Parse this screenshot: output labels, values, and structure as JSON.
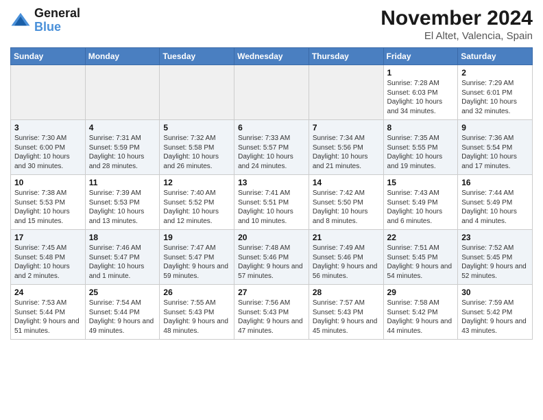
{
  "header": {
    "logo_line1": "General",
    "logo_line2": "Blue",
    "month_title": "November 2024",
    "location": "El Altet, Valencia, Spain"
  },
  "weekdays": [
    "Sunday",
    "Monday",
    "Tuesday",
    "Wednesday",
    "Thursday",
    "Friday",
    "Saturday"
  ],
  "weeks": [
    [
      {
        "day": "",
        "info": ""
      },
      {
        "day": "",
        "info": ""
      },
      {
        "day": "",
        "info": ""
      },
      {
        "day": "",
        "info": ""
      },
      {
        "day": "",
        "info": ""
      },
      {
        "day": "1",
        "info": "Sunrise: 7:28 AM\nSunset: 6:03 PM\nDaylight: 10 hours and 34 minutes."
      },
      {
        "day": "2",
        "info": "Sunrise: 7:29 AM\nSunset: 6:01 PM\nDaylight: 10 hours and 32 minutes."
      }
    ],
    [
      {
        "day": "3",
        "info": "Sunrise: 7:30 AM\nSunset: 6:00 PM\nDaylight: 10 hours and 30 minutes."
      },
      {
        "day": "4",
        "info": "Sunrise: 7:31 AM\nSunset: 5:59 PM\nDaylight: 10 hours and 28 minutes."
      },
      {
        "day": "5",
        "info": "Sunrise: 7:32 AM\nSunset: 5:58 PM\nDaylight: 10 hours and 26 minutes."
      },
      {
        "day": "6",
        "info": "Sunrise: 7:33 AM\nSunset: 5:57 PM\nDaylight: 10 hours and 24 minutes."
      },
      {
        "day": "7",
        "info": "Sunrise: 7:34 AM\nSunset: 5:56 PM\nDaylight: 10 hours and 21 minutes."
      },
      {
        "day": "8",
        "info": "Sunrise: 7:35 AM\nSunset: 5:55 PM\nDaylight: 10 hours and 19 minutes."
      },
      {
        "day": "9",
        "info": "Sunrise: 7:36 AM\nSunset: 5:54 PM\nDaylight: 10 hours and 17 minutes."
      }
    ],
    [
      {
        "day": "10",
        "info": "Sunrise: 7:38 AM\nSunset: 5:53 PM\nDaylight: 10 hours and 15 minutes."
      },
      {
        "day": "11",
        "info": "Sunrise: 7:39 AM\nSunset: 5:53 PM\nDaylight: 10 hours and 13 minutes."
      },
      {
        "day": "12",
        "info": "Sunrise: 7:40 AM\nSunset: 5:52 PM\nDaylight: 10 hours and 12 minutes."
      },
      {
        "day": "13",
        "info": "Sunrise: 7:41 AM\nSunset: 5:51 PM\nDaylight: 10 hours and 10 minutes."
      },
      {
        "day": "14",
        "info": "Sunrise: 7:42 AM\nSunset: 5:50 PM\nDaylight: 10 hours and 8 minutes."
      },
      {
        "day": "15",
        "info": "Sunrise: 7:43 AM\nSunset: 5:49 PM\nDaylight: 10 hours and 6 minutes."
      },
      {
        "day": "16",
        "info": "Sunrise: 7:44 AM\nSunset: 5:49 PM\nDaylight: 10 hours and 4 minutes."
      }
    ],
    [
      {
        "day": "17",
        "info": "Sunrise: 7:45 AM\nSunset: 5:48 PM\nDaylight: 10 hours and 2 minutes."
      },
      {
        "day": "18",
        "info": "Sunrise: 7:46 AM\nSunset: 5:47 PM\nDaylight: 10 hours and 1 minute."
      },
      {
        "day": "19",
        "info": "Sunrise: 7:47 AM\nSunset: 5:47 PM\nDaylight: 9 hours and 59 minutes."
      },
      {
        "day": "20",
        "info": "Sunrise: 7:48 AM\nSunset: 5:46 PM\nDaylight: 9 hours and 57 minutes."
      },
      {
        "day": "21",
        "info": "Sunrise: 7:49 AM\nSunset: 5:46 PM\nDaylight: 9 hours and 56 minutes."
      },
      {
        "day": "22",
        "info": "Sunrise: 7:51 AM\nSunset: 5:45 PM\nDaylight: 9 hours and 54 minutes."
      },
      {
        "day": "23",
        "info": "Sunrise: 7:52 AM\nSunset: 5:45 PM\nDaylight: 9 hours and 52 minutes."
      }
    ],
    [
      {
        "day": "24",
        "info": "Sunrise: 7:53 AM\nSunset: 5:44 PM\nDaylight: 9 hours and 51 minutes."
      },
      {
        "day": "25",
        "info": "Sunrise: 7:54 AM\nSunset: 5:44 PM\nDaylight: 9 hours and 49 minutes."
      },
      {
        "day": "26",
        "info": "Sunrise: 7:55 AM\nSunset: 5:43 PM\nDaylight: 9 hours and 48 minutes."
      },
      {
        "day": "27",
        "info": "Sunrise: 7:56 AM\nSunset: 5:43 PM\nDaylight: 9 hours and 47 minutes."
      },
      {
        "day": "28",
        "info": "Sunrise: 7:57 AM\nSunset: 5:43 PM\nDaylight: 9 hours and 45 minutes."
      },
      {
        "day": "29",
        "info": "Sunrise: 7:58 AM\nSunset: 5:42 PM\nDaylight: 9 hours and 44 minutes."
      },
      {
        "day": "30",
        "info": "Sunrise: 7:59 AM\nSunset: 5:42 PM\nDaylight: 9 hours and 43 minutes."
      }
    ]
  ]
}
